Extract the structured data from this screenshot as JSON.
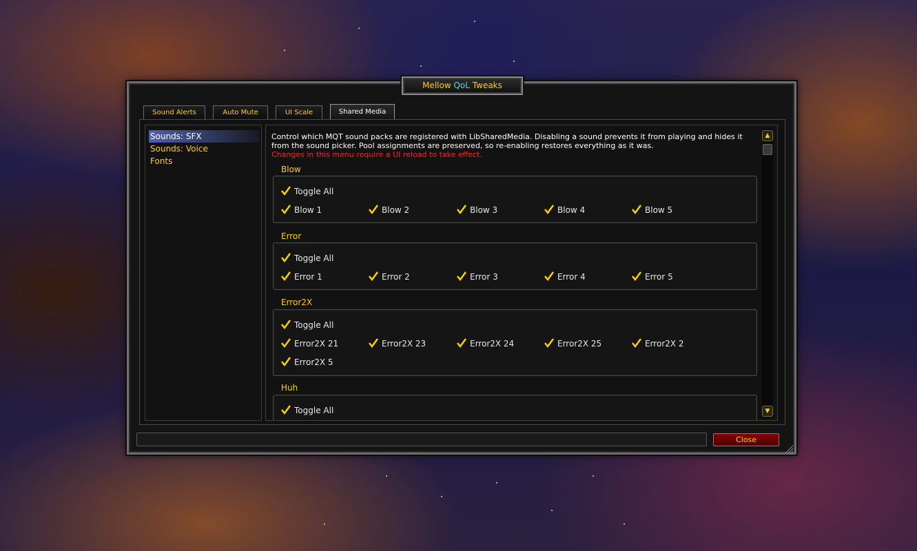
{
  "window": {
    "title_prefix": "Mellow ",
    "title_accent": "QoL",
    "title_suffix": " Tweaks",
    "accent_color": "#4ad9d9",
    "title_color": "#ffd100"
  },
  "tabs": [
    {
      "label": "Sound Alerts",
      "active": false
    },
    {
      "label": "Auto Mute",
      "active": false
    },
    {
      "label": "UI Scale",
      "active": false
    },
    {
      "label": "Shared Media",
      "active": true
    }
  ],
  "sidebar": {
    "items": [
      {
        "label": "Sounds: SFX",
        "selected": true
      },
      {
        "label": "Sounds: Voice",
        "selected": false
      },
      {
        "label": "Fonts",
        "selected": false
      }
    ]
  },
  "content": {
    "description": "Control which MQT sound packs are registered with LibSharedMedia. Disabling a sound prevents it from playing and hides it from the sound picker. Pool assignments are preserved, so re-enabling restores everything as it was.",
    "warning": "Changes in this menu require a UI reload to take effect.",
    "warning_color": "#ff2020",
    "groups": [
      {
        "title": "Blow",
        "toggle_all": "Toggle All",
        "items": [
          "Blow 1",
          "Blow 2",
          "Blow 3",
          "Blow 4",
          "Blow 5"
        ]
      },
      {
        "title": "Error",
        "toggle_all": "Toggle All",
        "items": [
          "Error 1",
          "Error 2",
          "Error 3",
          "Error 4",
          "Error 5"
        ]
      },
      {
        "title": "Error2X",
        "toggle_all": "Toggle All",
        "items": [
          "Error2X 21",
          "Error2X 23",
          "Error2X 24",
          "Error2X 25",
          "Error2X 2",
          "Error2X 5"
        ]
      },
      {
        "title": "Huh",
        "toggle_all": "Toggle All",
        "items": []
      }
    ],
    "scroll_up_icon": "scroll-up-arrow-icon",
    "scroll_down_icon": "scroll-down-arrow-icon"
  },
  "footer": {
    "close_label": "Close",
    "status_text": ""
  }
}
